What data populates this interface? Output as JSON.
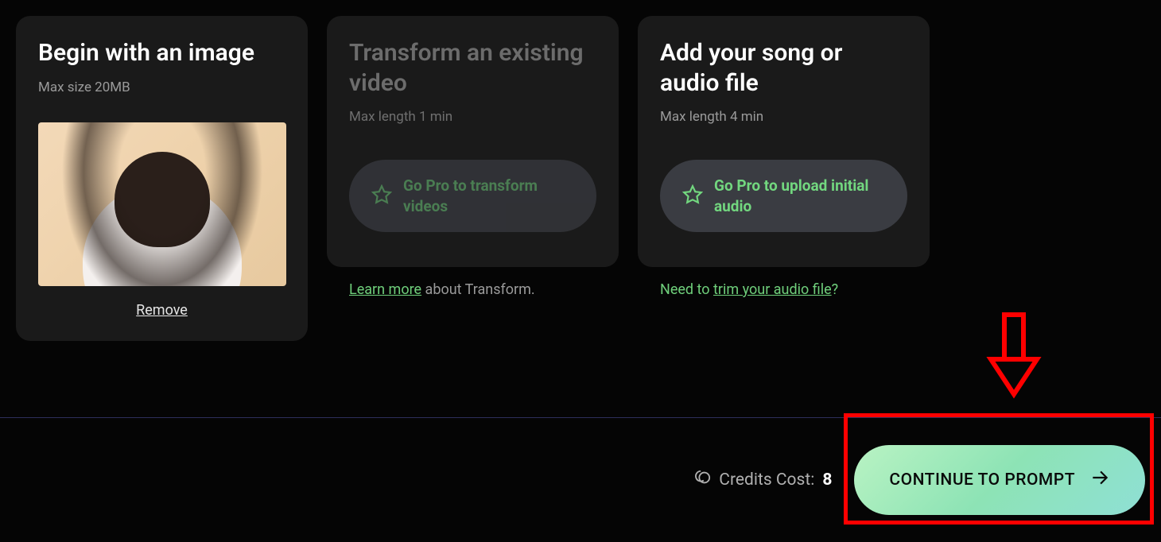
{
  "cards": {
    "image": {
      "title": "Begin with an image",
      "sub": "Max size 20MB",
      "remove": "Remove"
    },
    "video": {
      "title": "Transform an existing video",
      "sub": "Max length 1 min",
      "pro_label": "Go Pro to transform videos",
      "helper_link": "Learn more",
      "helper_rest": " about Transform."
    },
    "audio": {
      "title": "Add your song or audio file",
      "sub": "Max length 4 min",
      "pro_label": "Go Pro to upload initial audio",
      "helper_pre": "Need to ",
      "helper_link": "trim your audio file",
      "helper_post": "?"
    }
  },
  "footer": {
    "credits_label": "Credits Cost: ",
    "credits_value": "8",
    "cta": "CONTINUE TO PROMPT"
  }
}
